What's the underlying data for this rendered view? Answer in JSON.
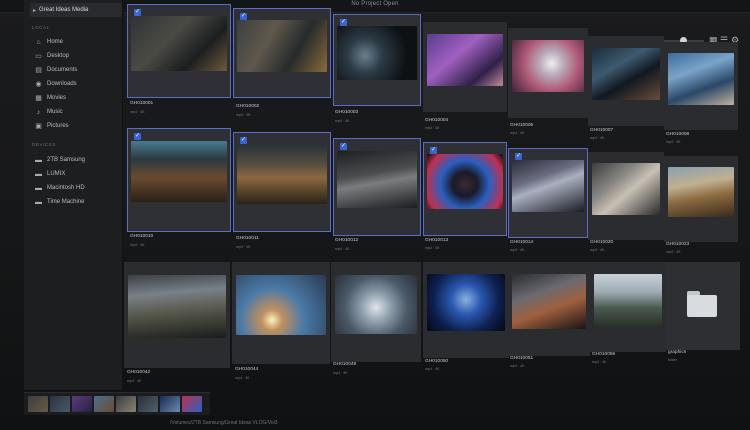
{
  "window": {
    "title": "No Project Open"
  },
  "sidebar": {
    "header": "Great Ideas Media",
    "local_title": "LOCAL",
    "local_items": [
      {
        "label": "Home",
        "icon": "home-icon"
      },
      {
        "label": "Desktop",
        "icon": "desktop-icon"
      },
      {
        "label": "Documents",
        "icon": "documents-icon"
      },
      {
        "label": "Downloads",
        "icon": "downloads-icon"
      },
      {
        "label": "Movies",
        "icon": "movies-icon"
      },
      {
        "label": "Music",
        "icon": "music-icon"
      },
      {
        "label": "Pictures",
        "icon": "pictures-icon"
      }
    ],
    "devices_title": "DEVICES",
    "devices": [
      {
        "label": "2TB Samsung",
        "icon": "drive-icon"
      },
      {
        "label": "LUMIX",
        "icon": "drive-icon"
      },
      {
        "label": "Macintosh HD",
        "icon": "drive-icon"
      },
      {
        "label": "Time Machine",
        "icon": "drive-icon"
      }
    ]
  },
  "toolbar": {
    "grid_view_icon": "grid-view-icon",
    "list_view_icon": "list-view-icon",
    "settings_icon": "sliders-icon"
  },
  "grid": {
    "rows": [
      {
        "clips": [
          {
            "name": "GH010001",
            "meta": "mp4 · 4K",
            "selected": true
          },
          {
            "name": "GH010002",
            "meta": "mp4 · 4K",
            "selected": true
          },
          {
            "name": "GH010003",
            "meta": "mp4 · 4K",
            "selected": true
          },
          {
            "name": "GH010004",
            "meta": "mp4 · 4K",
            "selected": false
          },
          {
            "name": "GH010005",
            "meta": "mp4 · 4K",
            "selected": false
          },
          {
            "name": "GH010007",
            "meta": "mp4 · 4K",
            "selected": false
          },
          {
            "name": "GH010008",
            "meta": "mp4 · 4K",
            "selected": false
          }
        ]
      },
      {
        "clips": [
          {
            "name": "GH010010",
            "meta": "mp4 · 4K",
            "selected": true
          },
          {
            "name": "GH010011",
            "meta": "mp4 · 4K",
            "selected": true
          },
          {
            "name": "GH010012",
            "meta": "mp4 · 4K",
            "selected": true
          },
          {
            "name": "GH010013",
            "meta": "mp4 · 4K",
            "selected": true
          },
          {
            "name": "GH010014",
            "meta": "mp4 · 4K",
            "selected": true
          },
          {
            "name": "GH010020",
            "meta": "mp4 · 4K",
            "selected": false
          },
          {
            "name": "GH010023",
            "meta": "mp4 · 4K",
            "selected": false
          }
        ]
      },
      {
        "clips": [
          {
            "name": "GH010042",
            "meta": "mp4 · 4K",
            "selected": false
          },
          {
            "name": "GH010044",
            "meta": "mp4 · 4K",
            "selected": false
          },
          {
            "name": "GH010049",
            "meta": "mp4 · 4K",
            "selected": false
          },
          {
            "name": "GH010050",
            "meta": "mp4 · 4K",
            "selected": false
          },
          {
            "name": "GH010051",
            "meta": "mp4 · 4K",
            "selected": false
          },
          {
            "name": "GH010055",
            "meta": "mp4 · 4K",
            "selected": false
          },
          {
            "name": "graphics",
            "meta": "folder",
            "selected": false,
            "is_folder": true
          }
        ]
      }
    ]
  },
  "statusbar": {
    "path": "/Volumes/2TB Samsung/Great Ideas VLOG/Vol3"
  },
  "colors": {
    "selection": "#5b6cc4",
    "checkbox": "#3a63d4",
    "background": "#161718"
  }
}
